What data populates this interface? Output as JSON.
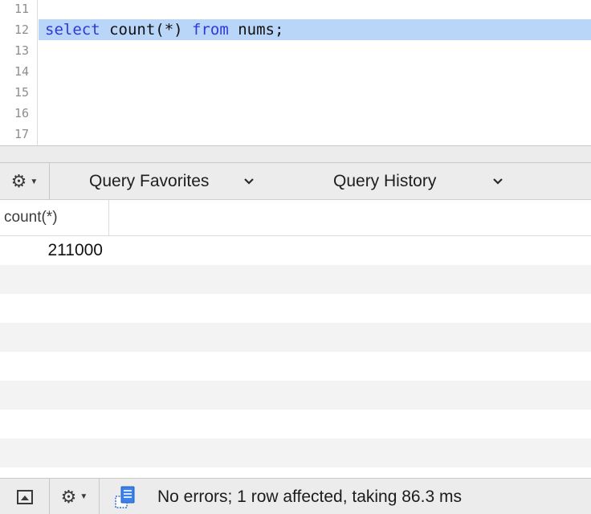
{
  "editor": {
    "lines": [
      {
        "number": "11",
        "tokens": []
      },
      {
        "number": "12",
        "tokens": [
          {
            "text": "select",
            "kind": "keyword"
          },
          {
            "text": " count(*) ",
            "kind": "plain"
          },
          {
            "text": "from",
            "kind": "keyword"
          },
          {
            "text": " nums;",
            "kind": "plain"
          }
        ],
        "highlighted": true
      },
      {
        "number": "13",
        "tokens": []
      },
      {
        "number": "14",
        "tokens": []
      },
      {
        "number": "15",
        "tokens": []
      },
      {
        "number": "16",
        "tokens": []
      },
      {
        "number": "17",
        "tokens": []
      }
    ]
  },
  "query_toolbar": {
    "gear_icon": "gear-icon",
    "favorites_label": "Query Favorites",
    "history_label": "Query History",
    "chevron_icon": "chevron-down-icon"
  },
  "results": {
    "columns": [
      "count(*)"
    ],
    "rows": [
      [
        "211000"
      ]
    ]
  },
  "status_bar": {
    "message": "No errors; 1 row affected, taking 86.3 ms",
    "icons": [
      "toggle-panel-icon",
      "gear-icon",
      "query-info-icon"
    ]
  },
  "colors": {
    "keyword": "#2c3bd8",
    "selection": "#b9d5f8",
    "toolbar_bg": "#ececec",
    "alt_row": "#f3f3f3"
  }
}
